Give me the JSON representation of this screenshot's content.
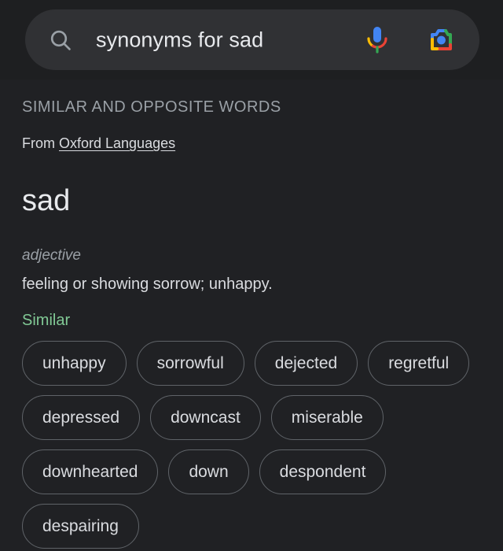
{
  "search": {
    "query": "synonyms for sad",
    "placeholder": "Search",
    "search_icon": "search-icon",
    "mic_icon": "microphone-icon",
    "lens_icon": "google-lens-camera-icon"
  },
  "result": {
    "section_label": "SIMILAR AND OPPOSITE WORDS",
    "source_prefix": "From ",
    "source_link": "Oxford Languages",
    "headword": "sad",
    "part_of_speech": "adjective",
    "definition": "feeling or showing sorrow; unhappy.",
    "similar_label": "Similar",
    "similar_words": [
      "unhappy",
      "sorrowful",
      "dejected",
      "regretful",
      "depressed",
      "downcast",
      "miserable",
      "downhearted",
      "down",
      "despondent",
      "despairing"
    ]
  },
  "colors": {
    "page_background": "#202124",
    "header_background": "#1e1f21",
    "search_pill_background": "#303134",
    "primary_text": "#e8eaed",
    "secondary_text": "#dadce0",
    "muted_text": "#9aa0a6",
    "similar_accent": "#81c995",
    "chip_border": "#5f6368",
    "google_blue": "#4285f4",
    "google_red": "#ea4335",
    "google_yellow": "#fbbc05",
    "google_green": "#34a853"
  }
}
